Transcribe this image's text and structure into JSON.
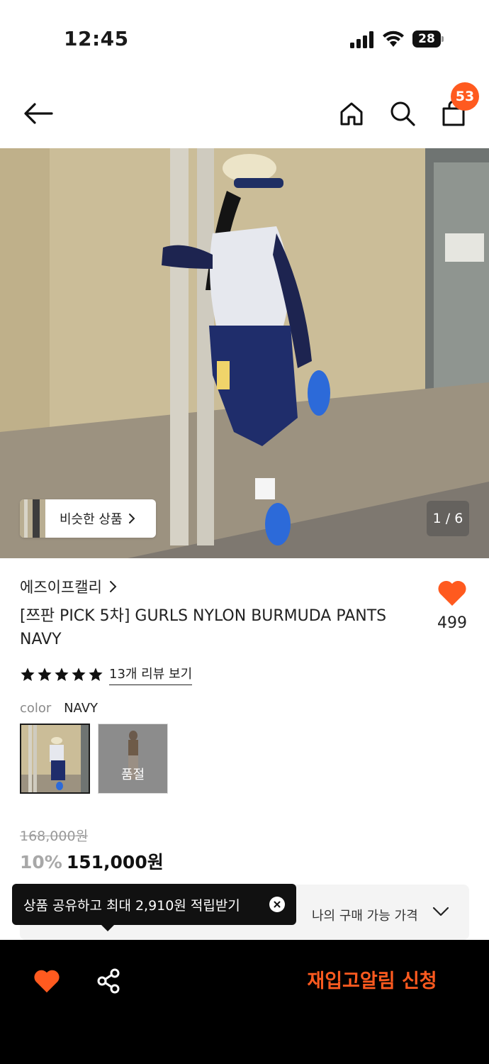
{
  "status_bar": {
    "time": "12:45",
    "battery": "28"
  },
  "header": {
    "cart_count": "53"
  },
  "hero": {
    "similar_label": "비슷한 상품",
    "page_indicator": "1 / 6"
  },
  "product": {
    "brand": "에즈이프캘리",
    "title": "[쯔판 PICK 5차] GURLS NYLON BURMUDA PANTS NAVY",
    "likes": "499",
    "rating_stars": 5,
    "review_link": "13개 리뷰 보기",
    "color_label": "color",
    "color_value": "NAVY",
    "soldout_label": "품절",
    "original_price": "168,000원",
    "discount": "10%",
    "sale_price": "151,000원"
  },
  "my_price": {
    "label": "나의 구매 가능 가격"
  },
  "tooltip": {
    "text": "상품 공유하고 최대 2,910원 적립받기"
  },
  "bottom_bar": {
    "restock_label": "재입고알림 신청"
  },
  "colors": {
    "accent": "#ff5a1f",
    "text": "#1a1a1a",
    "muted": "#9a9a9a"
  }
}
